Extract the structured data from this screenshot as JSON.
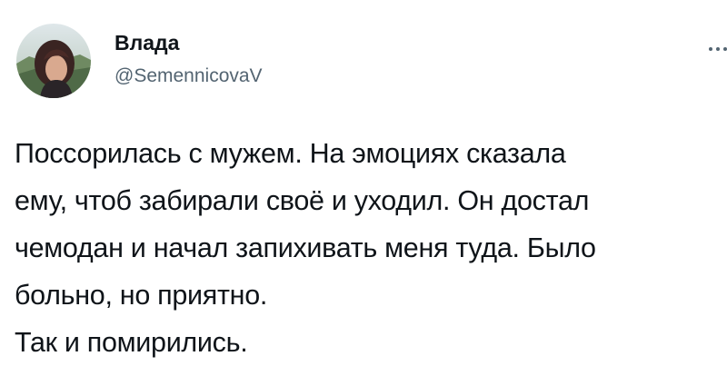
{
  "tweet": {
    "author": {
      "display_name": "Влада",
      "handle": "@SemennicovaV",
      "avatar_icon": "profile-photo"
    },
    "more_icon": "more-options-icon",
    "text_lines": [
      "Поссорилась с мужем. На эмоциях сказала",
      "ему, чтоб забирали своё и уходил. Он достал",
      "чемодан и начал запихивать меня туда. Было",
      "больно, но приятно.",
      "Так и помирились."
    ]
  }
}
